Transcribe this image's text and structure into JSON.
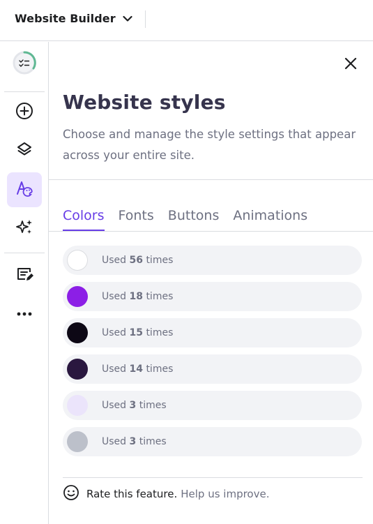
{
  "header": {
    "app_title": "Website Builder",
    "dropdown_icon": "chevron-down-icon"
  },
  "sidebar": {
    "items": [
      {
        "icon": "progress-checklist-icon",
        "active": false
      },
      {
        "icon": "add-circle-icon",
        "active": false
      },
      {
        "icon": "layers-icon",
        "active": false
      },
      {
        "icon": "styles-palette-icon",
        "active": true
      },
      {
        "icon": "ai-sparkles-icon",
        "active": false
      },
      {
        "icon": "edit-text-icon",
        "active": false
      },
      {
        "icon": "more-dots-icon",
        "active": false
      }
    ]
  },
  "panel": {
    "title": "Website styles",
    "description": "Choose and manage the style settings that appear across your entire site.",
    "tabs": [
      {
        "label": "Colors",
        "active": true
      },
      {
        "label": "Fonts",
        "active": false
      },
      {
        "label": "Buttons",
        "active": false
      },
      {
        "label": "Animations",
        "active": false
      }
    ],
    "colors": [
      {
        "hex": "#ffffff",
        "prefix": "Used",
        "count": "56",
        "suffix": "times"
      },
      {
        "hex": "#8c1fe6",
        "prefix": "Used",
        "count": "18",
        "suffix": "times"
      },
      {
        "hex": "#0d0815",
        "prefix": "Used",
        "count": "15",
        "suffix": "times"
      },
      {
        "hex": "#2a173f",
        "prefix": "Used",
        "count": "14",
        "suffix": "times"
      },
      {
        "hex": "#ebe4fb",
        "prefix": "Used",
        "count": "3",
        "suffix": "times"
      },
      {
        "hex": "#bcc0ca",
        "prefix": "Used",
        "count": "3",
        "suffix": "times"
      }
    ],
    "footer": {
      "rate_text": "Rate this feature.",
      "help_text": "Help us improve."
    }
  },
  "theme": {
    "accent": "#673de6",
    "active_bg": "#ebe4ff",
    "text_dark": "#36344d",
    "text_muted": "#6d7081"
  }
}
